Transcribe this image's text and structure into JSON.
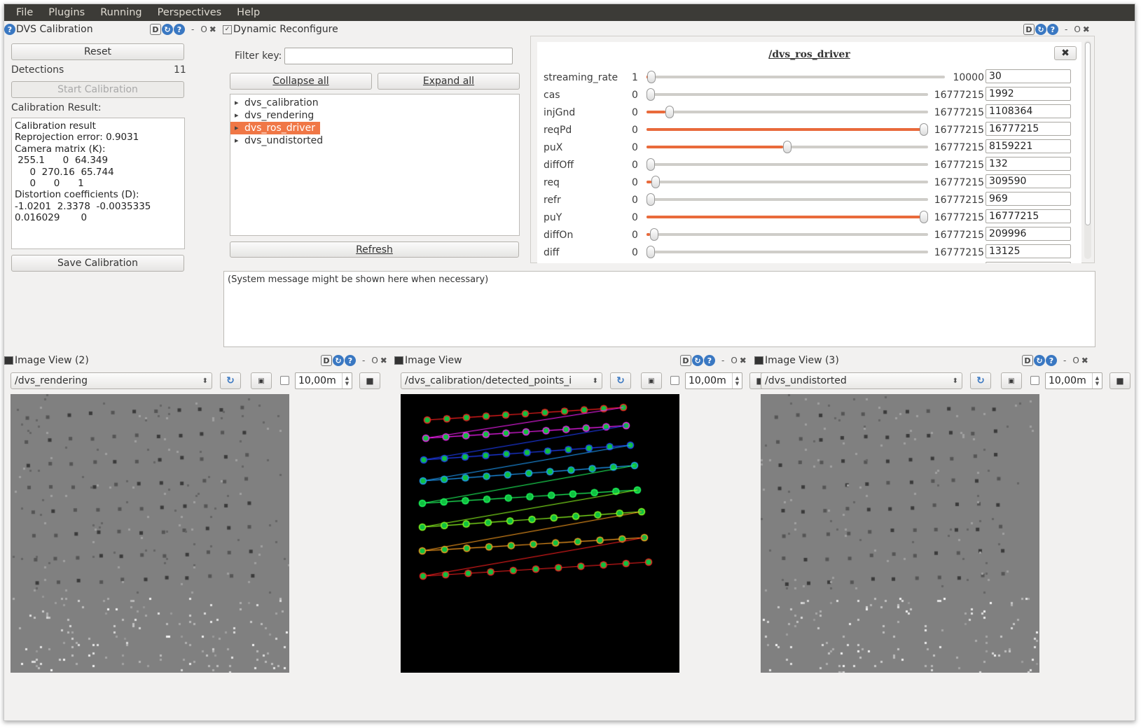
{
  "menu": [
    "File",
    "Plugins",
    "Running",
    "Perspectives",
    "Help"
  ],
  "calib": {
    "title": "DVS Calibration",
    "reset": "Reset",
    "detections_label": "Detections",
    "detections_value": "11",
    "start": "Start Calibration",
    "result_label": "Calibration Result:",
    "result_lines": [
      "Calibration result",
      "Reprojection error: 0.9031",
      "Camera matrix (K):",
      " 255.1      0  64.349",
      "     0  270.16  65.744",
      "     0      0      1",
      "Distortion coefficients (D):",
      "-1.0201  2.3378  -0.0035335",
      "0.016029       0"
    ],
    "save": "Save Calibration"
  },
  "reconf": {
    "title": "Dynamic Reconfigure",
    "filter_label": "Filter key:",
    "filter_value": "",
    "collapse": "Collapse all",
    "expand": "Expand all",
    "tree": [
      "dvs_calibration",
      "dvs_rendering",
      "dvs_ros_driver",
      "dvs_undistorted"
    ],
    "selected_index": 2,
    "refresh": "Refresh",
    "node_title": "/dvs_ros_driver",
    "params": [
      {
        "name": "streaming_rate",
        "min": "1",
        "max": "10000",
        "value": "30",
        "frac": 0.003
      },
      {
        "name": "cas",
        "min": "0",
        "max": "16777215",
        "value": "1992",
        "frac": 0.0
      },
      {
        "name": "injGnd",
        "min": "0",
        "max": "16777215",
        "value": "1108364",
        "frac": 0.066
      },
      {
        "name": "reqPd",
        "min": "0",
        "max": "16777215",
        "value": "16777215",
        "frac": 1.0
      },
      {
        "name": "puX",
        "min": "0",
        "max": "16777215",
        "value": "8159221",
        "frac": 0.486
      },
      {
        "name": "diffOff",
        "min": "0",
        "max": "16777215",
        "value": "132",
        "frac": 0.0
      },
      {
        "name": "req",
        "min": "0",
        "max": "16777215",
        "value": "309590",
        "frac": 0.018
      },
      {
        "name": "refr",
        "min": "0",
        "max": "16777215",
        "value": "969",
        "frac": 0.0
      },
      {
        "name": "puY",
        "min": "0",
        "max": "16777215",
        "value": "16777215",
        "frac": 1.0
      },
      {
        "name": "diffOn",
        "min": "0",
        "max": "16777215",
        "value": "209996",
        "frac": 0.0125
      },
      {
        "name": "diff",
        "min": "0",
        "max": "16777215",
        "value": "13125",
        "frac": 0.0
      }
    ]
  },
  "console": {
    "message": "(System message might be shown here when necessary)"
  },
  "views": [
    {
      "title": "Image View (2)",
      "topic": "/dvs_rendering",
      "rate": "10,00m"
    },
    {
      "title": "Image View",
      "topic": "/dvs_calibration/detected_points_i",
      "rate": "10,00m"
    },
    {
      "title": "Image View (3)",
      "topic": "/dvs_undistorted",
      "rate": "10,00m"
    }
  ],
  "colors": {
    "accent": "#f07746",
    "menubar": "#3c3b37"
  }
}
